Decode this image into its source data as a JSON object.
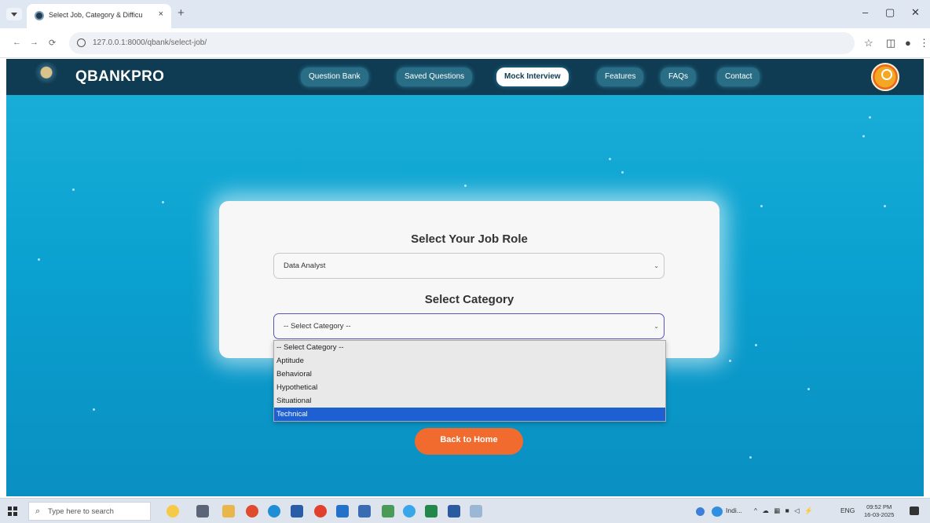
{
  "browser": {
    "tab_title": "Select Job, Category & Difficul",
    "tab_close": "×",
    "new_tab": "+",
    "window_controls": {
      "minimize": "–",
      "maximize": "▢",
      "close": "✕"
    },
    "url": "127.0.0.1:8000/qbank/select-job/",
    "nav_icons": {
      "back": "←",
      "forward": "→",
      "reload": "⟳"
    }
  },
  "site": {
    "brand": "QBANKPRO",
    "nav": [
      "Question Bank",
      "Saved Questions",
      "Mock Interview",
      "Features",
      "FAQs",
      "Contact"
    ],
    "active_nav": "Mock Interview",
    "card": {
      "job_heading": "Select Your Job Role",
      "job_value": "Data Analyst",
      "category_heading": "Select Category",
      "category_value": "-- Select Category --"
    },
    "dropdown_options": [
      "-- Select Category --",
      "Aptitude",
      "Behavioral",
      "Hypothetical",
      "Situational",
      "Technical"
    ],
    "dropdown_highlighted": "Technical",
    "back_button": "Back to Home"
  },
  "taskbar": {
    "search_placeholder": "Type here to search",
    "tray_text": "ENG",
    "weather_text": "Indi...",
    "time": "09:52 PM",
    "date": "16-03-2025"
  }
}
